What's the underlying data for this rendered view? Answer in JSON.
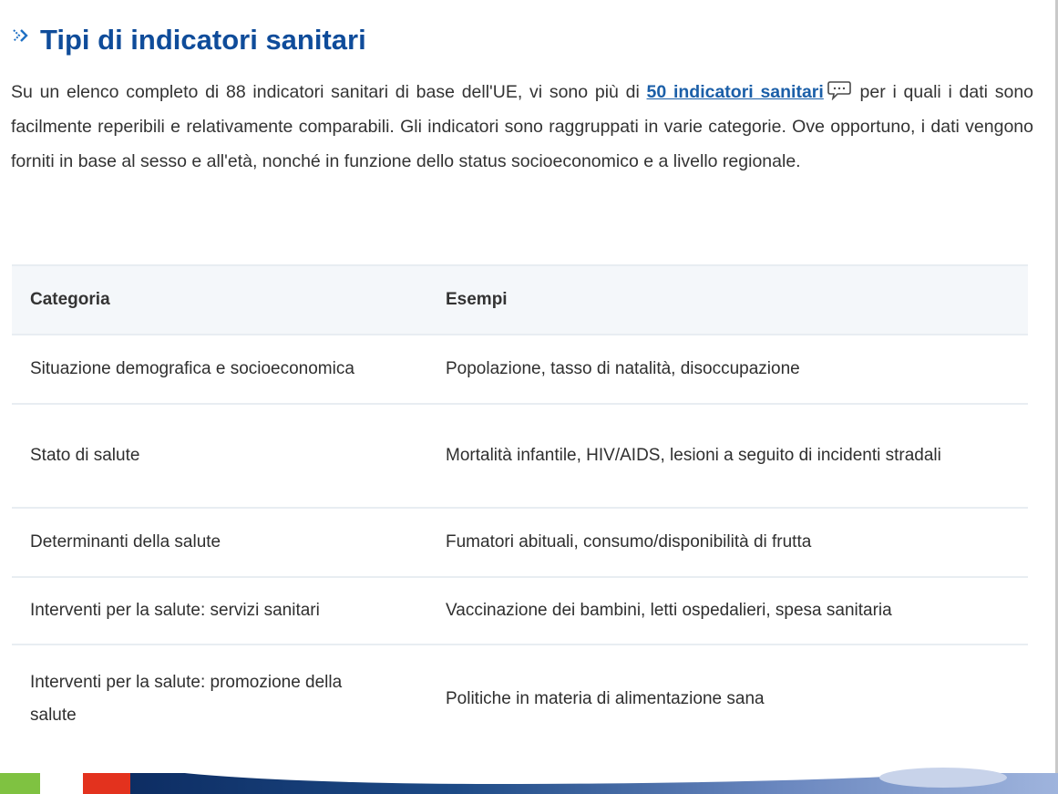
{
  "heading": {
    "icon": "double-chevron-right-icon",
    "title": "Tipi di indicatori sanitari"
  },
  "intro": {
    "before_link": "Su un elenco completo di 88 indicatori sanitari di base dell'UE, vi sono più di ",
    "link_text": "50 indicatori sanitari",
    "link_icon": "speech-bubble-icon",
    "after_link": " per i quali i dati sono facilmente reperibili e relativamente comparabili. Gli indicatori sono raggruppati in varie categorie. Ove opportuno, i dati vengono forniti in base al sesso e all'età, nonché in funzione dello status socioeconomico e a livello regionale."
  },
  "table": {
    "headers": [
      "Categoria",
      "Esempi"
    ],
    "rows": [
      {
        "category": "Situazione demografica e socioeconomica",
        "examples": "Popolazione, tasso di natalità, disoccupazione"
      },
      {
        "category": "Stato di salute",
        "examples": "Mortalità infantile, HIV/AIDS, lesioni a seguito di incidenti stradali"
      },
      {
        "category": "Determinanti della salute",
        "examples": "Fumatori abituali, consumo/disponibilità di frutta"
      },
      {
        "category": "Interventi per la salute: servizi sanitari",
        "examples": "Vaccinazione dei bambini, letti ospedalieri, spesa sanitaria"
      },
      {
        "category": "Interventi per la salute: promozione della salute",
        "examples": "Politiche in materia di alimentazione sana"
      }
    ]
  },
  "colors": {
    "heading": "#0f4c9a",
    "link": "#1b5fa8",
    "header_bg": "#f4f7fa",
    "bar_green": "#7fc241",
    "bar_red": "#e3321e",
    "bar_blue": "#0d2d63"
  }
}
